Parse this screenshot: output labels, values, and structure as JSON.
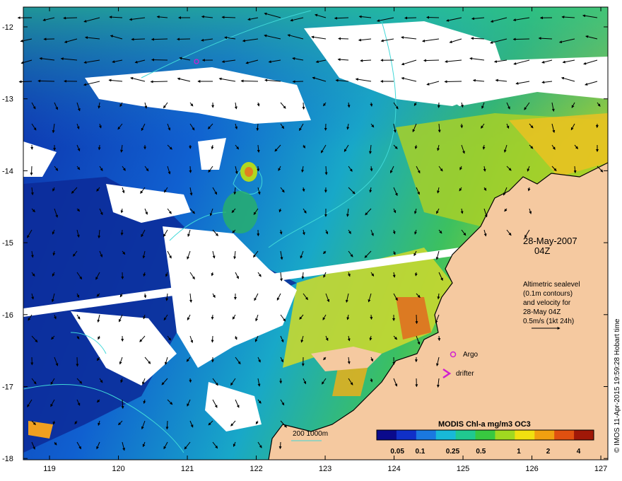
{
  "map": {
    "date": "28-May-2007",
    "time": "04Z",
    "x_ticks": [
      "119",
      "120",
      "121",
      "122",
      "123",
      "124",
      "125",
      "126",
      "127"
    ],
    "y_ticks": [
      "-12",
      "-13",
      "-14",
      "-15",
      "-16",
      "-17",
      "-18"
    ]
  },
  "info": {
    "lines": [
      "Altimetric sealevel",
      "(0.1m contours)",
      "and velocity for",
      "28-May 04Z",
      "0.5m/s (1kt 24h)"
    ]
  },
  "legend": {
    "argo": "Argo",
    "drifter": "drifter",
    "isobath": "200  1000m"
  },
  "colorbar": {
    "title": "MODIS Chl-a mg/m3 OC3",
    "ticks": [
      "0.05",
      "0.1",
      "0.25",
      "0.5",
      "1",
      "2",
      "4"
    ],
    "colors": [
      "#0a0a8c",
      "#1030c8",
      "#1a78e0",
      "#18b8d8",
      "#20c890",
      "#38c840",
      "#a0d820",
      "#f0e010",
      "#f0a010",
      "#e05010",
      "#a01808"
    ]
  },
  "credit": "© IMOS 11-Apr-2015 19:59:28 Hobart time",
  "colors": {
    "land": "#f5c9a0",
    "cloud": "#ffffff",
    "contour": "#40d8d8",
    "argo": "#d020d0"
  }
}
